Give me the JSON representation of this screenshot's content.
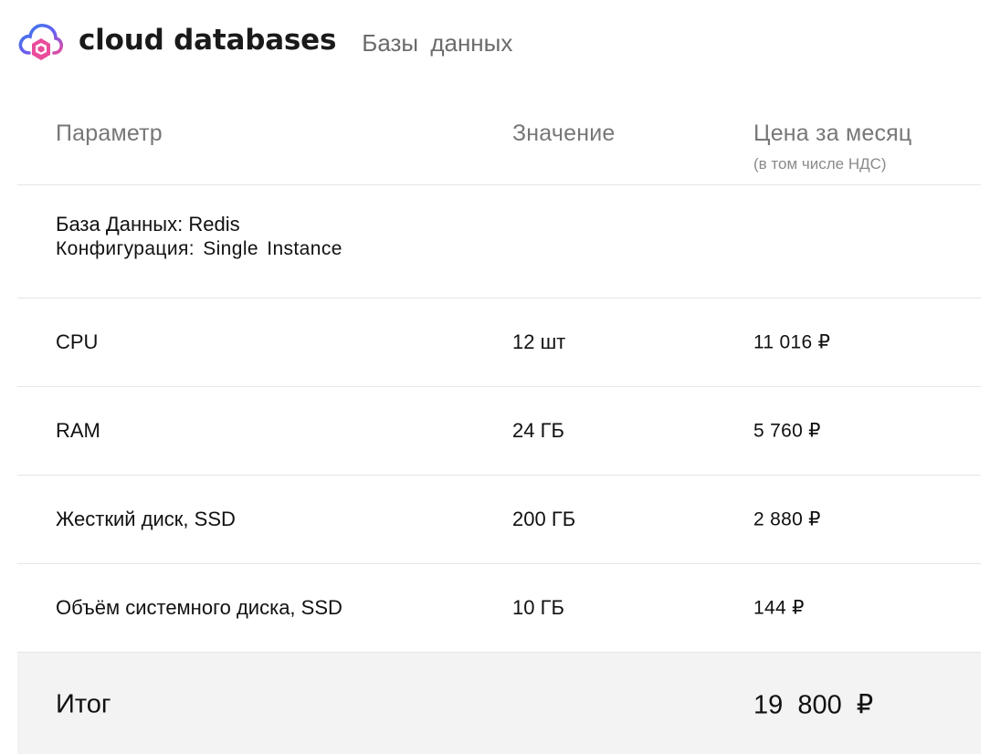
{
  "header": {
    "brand": "cloud databases",
    "section": "Базы данных",
    "logo_icon": "cloud-database-logo-icon"
  },
  "table": {
    "columns": {
      "param": "Параметр",
      "value": "Значение",
      "price": "Цена за месяц",
      "price_note": "(в том числе НДС)"
    },
    "database": {
      "name": "База Данных: Redis",
      "config": "Конфигурация: Single Instance"
    },
    "rows": [
      {
        "param": "CPU",
        "value": "12 шт",
        "price": "11 016 ₽"
      },
      {
        "param": "RAM",
        "value": "24 ГБ",
        "price": "5 760 ₽"
      },
      {
        "param": "Жесткий диск, SSD",
        "value": "200 ГБ",
        "price": "2 880 ₽"
      },
      {
        "param": "Объём системного диска, SSD",
        "value": "10 ГБ",
        "price": "144 ₽"
      }
    ],
    "total": {
      "label": "Итог",
      "price": "19 800 ₽"
    }
  },
  "colors": {
    "logo_blue": "#3b82f6",
    "logo_pink": "#ec4899",
    "total_background": "#f3f3f3",
    "header_text_gray": "#777777"
  }
}
